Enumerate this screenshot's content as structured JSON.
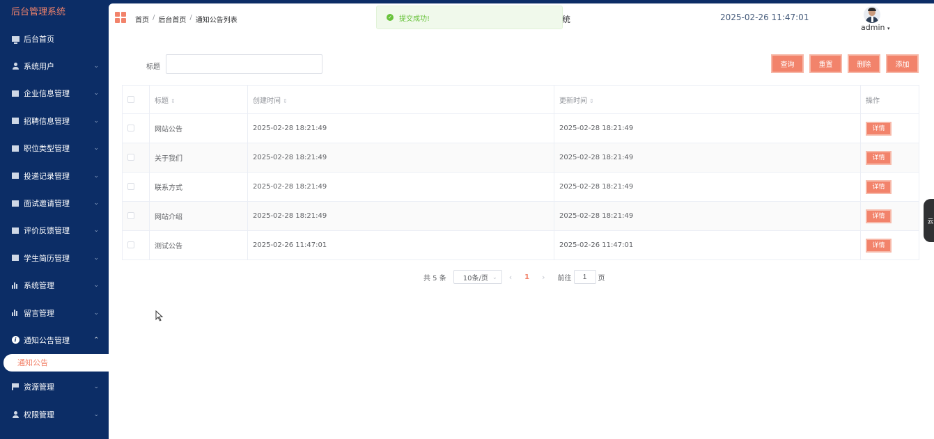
{
  "app_title": "后台管理系统",
  "sidebar": {
    "items": [
      {
        "label": "后台首页",
        "icon": "monitor-icon",
        "arrow": ""
      },
      {
        "label": "系统用户",
        "icon": "user-icon",
        "arrow": "⌄"
      },
      {
        "label": "企业信息管理",
        "icon": "chart-box-icon",
        "arrow": "⌄"
      },
      {
        "label": "招聘信息管理",
        "icon": "chart-box-icon",
        "arrow": "⌄"
      },
      {
        "label": "职位类型管理",
        "icon": "chart-box-icon",
        "arrow": "⌄"
      },
      {
        "label": "投递记录管理",
        "icon": "chart-box-icon",
        "arrow": "⌄"
      },
      {
        "label": "面试邀请管理",
        "icon": "chart-box-icon",
        "arrow": "⌄"
      },
      {
        "label": "评价反馈管理",
        "icon": "chart-box-icon",
        "arrow": "⌄"
      },
      {
        "label": "学生简历管理",
        "icon": "chart-box-icon",
        "arrow": "⌄"
      },
      {
        "label": "系统管理",
        "icon": "bar-chart-icon",
        "arrow": "⌄"
      },
      {
        "label": "留言管理",
        "icon": "bar-chart-icon",
        "arrow": "⌄"
      },
      {
        "label": "通知公告管理",
        "icon": "info-icon",
        "arrow": "⌃"
      },
      {
        "label": "资源管理",
        "icon": "flag-icon",
        "arrow": "⌄"
      },
      {
        "label": "权限管理",
        "icon": "user-icon",
        "arrow": "⌄"
      }
    ],
    "active_submenu": "通知公告"
  },
  "header": {
    "breadcrumb": [
      "首页",
      "后台首页",
      "通知公告列表"
    ],
    "breadcrumb_sep": "/",
    "system_title_fragment": "统",
    "datetime": "2025-02-26 11:47:01",
    "user": "admin"
  },
  "toast": {
    "icon": "✓",
    "message": "提交成功!"
  },
  "search": {
    "label": "标题",
    "value": "",
    "placeholder": ""
  },
  "actions": {
    "query": "查询",
    "reset": "重置",
    "delete": "删除",
    "add": "添加"
  },
  "table": {
    "columns": [
      "标题",
      "创建时间",
      "更新时间",
      "操作"
    ],
    "sort_icon": "⇕",
    "rows": [
      {
        "title": "网站公告",
        "created": "2025-02-28 18:21:49",
        "updated": "2025-02-28 18:21:49",
        "action": "详情"
      },
      {
        "title": "关于我们",
        "created": "2025-02-28 18:21:49",
        "updated": "2025-02-28 18:21:49",
        "action": "详情"
      },
      {
        "title": "联系方式",
        "created": "2025-02-28 18:21:49",
        "updated": "2025-02-28 18:21:49",
        "action": "详情"
      },
      {
        "title": "网站介绍",
        "created": "2025-02-28 18:21:49",
        "updated": "2025-02-28 18:21:49",
        "action": "详情"
      },
      {
        "title": "测试公告",
        "created": "2025-02-26 11:47:01",
        "updated": "2025-02-26 11:47:01",
        "action": "详情"
      }
    ]
  },
  "pagination": {
    "total": "共 5 条",
    "page_size": "10条/页",
    "prev": "‹",
    "current": "1",
    "next": "›",
    "jump_prefix": "前往",
    "jump_value": "1",
    "jump_suffix": "页"
  },
  "side_tab": {
    "label": "云"
  },
  "colors": {
    "sidebar_bg": "#0c2d66",
    "accent": "#f2836b",
    "success": "#67c23a"
  }
}
